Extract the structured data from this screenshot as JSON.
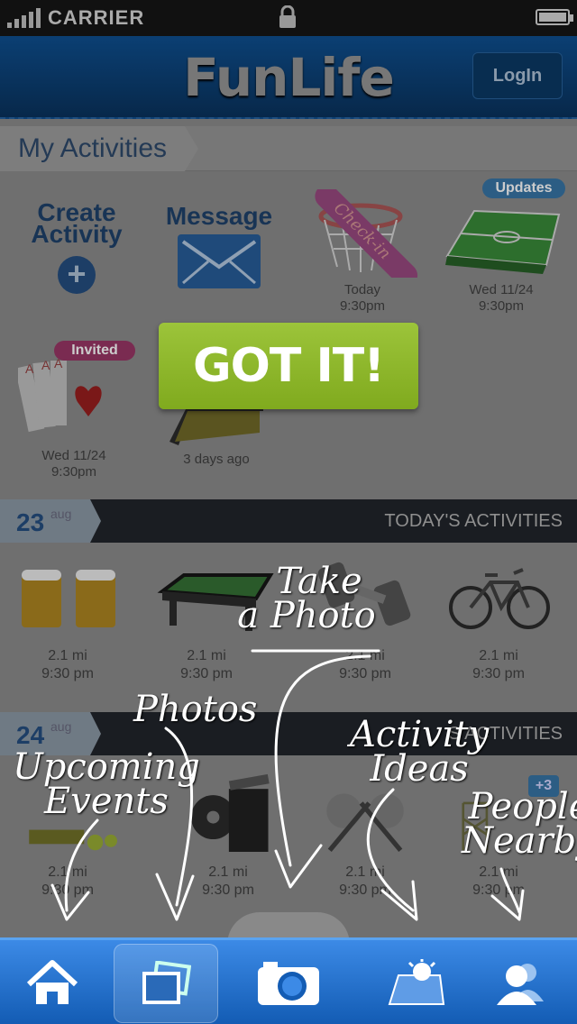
{
  "status": {
    "carrier": "CARRIER"
  },
  "header": {
    "logo": "FunLife",
    "login_label": "LogIn"
  },
  "my_activities": {
    "title": "My Activities",
    "create_label_1": "Create",
    "create_label_2": "Activity",
    "message_label": "Message",
    "checkin_label": "Check-in",
    "checkin_when": "Today",
    "checkin_time": "9:30pm",
    "soccer_badge": "Updates",
    "soccer_when": "Wed 11/24",
    "soccer_time": "9:30pm",
    "cards_badge": "Invited",
    "cards_when": "Wed 11/24",
    "cards_time": "9:30pm",
    "photo_when": "3 days ago"
  },
  "overlay": {
    "got_it": "GOT IT!"
  },
  "today": {
    "day": "23",
    "month": "aug",
    "title": "TODAY'S ACTIVITIES",
    "items": [
      {
        "dist": "2.1 mi",
        "time": "9:30 pm",
        "icon": "beer-icon"
      },
      {
        "dist": "2.1 mi",
        "time": "9:30 pm",
        "icon": "pool-table-icon"
      },
      {
        "dist": "2.1 mi",
        "time": "9:30 pm",
        "icon": "dumbbell-icon"
      },
      {
        "dist": "2.1 mi",
        "time": "9:30 pm",
        "icon": "bicycle-icon"
      }
    ]
  },
  "tomorrow": {
    "day": "24",
    "month": "aug",
    "title": "S ACTIVITIES",
    "more": "+3",
    "items": [
      {
        "dist": "2.1 mi",
        "time": "9:30 pm"
      },
      {
        "dist": "2.1 mi",
        "time": "9:30 pm"
      },
      {
        "dist": "2.1 mi",
        "time": "9:30 pm"
      },
      {
        "dist": "2.1 mi",
        "time": "9:30 pm"
      }
    ]
  },
  "annotations": {
    "take_photo_1": "Take",
    "take_photo_2": "a Photo",
    "photos": "Photos",
    "upcoming_1": "Upcoming",
    "upcoming_2": "Events",
    "ideas_1": "Activity",
    "ideas_2": "Ideas",
    "people_1": "People",
    "people_2": "Nearby"
  },
  "tabbar": {
    "tabs": [
      "home-icon",
      "photos-icon",
      "camera-icon",
      "ideas-icon",
      "people-icon"
    ],
    "active": 1
  }
}
